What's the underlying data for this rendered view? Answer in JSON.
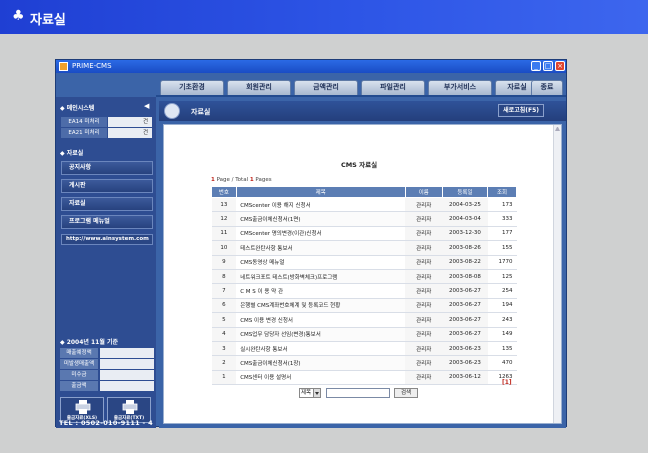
{
  "page": {
    "title": "자료실"
  },
  "window": {
    "title": "PRIME-CMS"
  },
  "menu": {
    "tabs": [
      {
        "label": "기초환경"
      },
      {
        "label": "회원관리"
      },
      {
        "label": "금액관리"
      },
      {
        "label": "파일관리"
      },
      {
        "label": "부가서비스"
      },
      {
        "label": "자료실"
      },
      {
        "label": "종료"
      }
    ]
  },
  "sidebar": {
    "main_system": "메인시스템",
    "counts": [
      {
        "label": "EA14 미처리",
        "value": "건"
      },
      {
        "label": "EA21 미처리",
        "value": "건"
      }
    ],
    "archive_head": "자료실",
    "nav": [
      {
        "label": "공지사항"
      },
      {
        "label": "게시판"
      },
      {
        "label": "자료실"
      },
      {
        "label": "프로그램 메뉴얼"
      }
    ],
    "url": "http://www.ainsystem.com",
    "stats_head": "2004년 11월 기준",
    "stats": [
      {
        "label": "매출예정액"
      },
      {
        "label": "미발생매출액"
      },
      {
        "label": "미수금"
      },
      {
        "label": "출금액"
      }
    ],
    "printers": [
      {
        "label": "출금자료(XLS)"
      },
      {
        "label": "출금자료(TXT)"
      }
    ],
    "phone": "TEL : 0502-010-9111 - 4"
  },
  "content": {
    "title": "자료실",
    "refresh_label": "새로고침(F5)",
    "board_title": "CMS 자료실",
    "page_current": "1",
    "page_total": "1",
    "page_text_a": " Page / Total ",
    "page_text_b": " Pages",
    "columns": {
      "no": "번호",
      "subject": "제목",
      "name": "이름",
      "date": "등록일",
      "views": "조회"
    },
    "rows": [
      {
        "no": "13",
        "subject": "CMScenter 이용 해지 신청서",
        "name": "관리자",
        "date": "2004-03-25",
        "views": "173"
      },
      {
        "no": "12",
        "subject": "CMS출금이체신청서(1면)",
        "name": "관리자",
        "date": "2004-03-04",
        "views": "333"
      },
      {
        "no": "11",
        "subject": "CMScenter 명의변경(이관)신청서",
        "name": "관리자",
        "date": "2003-12-30",
        "views": "177"
      },
      {
        "no": "10",
        "subject": "테스트완탄사항 통보서",
        "name": "관리자",
        "date": "2003-08-26",
        "views": "155"
      },
      {
        "no": "9",
        "subject": "CMS동영상 메뉴얼",
        "name": "관리자",
        "date": "2003-08-22",
        "views": "1770"
      },
      {
        "no": "8",
        "subject": "네트워크포트 테스트(방화벽체크)프로그램",
        "name": "관리자",
        "date": "2003-08-08",
        "views": "125"
      },
      {
        "no": "7",
        "subject": "C M S 이 용 약 관",
        "name": "관리자",
        "date": "2003-06-27",
        "views": "254"
      },
      {
        "no": "6",
        "subject": "은행별 CMS계좌번호체계 및 등록코드 현황",
        "name": "관리자",
        "date": "2003-06-27",
        "views": "194"
      },
      {
        "no": "5",
        "subject": "CMS 이용 변경 신청서",
        "name": "관리자",
        "date": "2003-06-27",
        "views": "243"
      },
      {
        "no": "4",
        "subject": "CMS업무 담당자 선임(변경)통보서",
        "name": "관리자",
        "date": "2003-06-27",
        "views": "149"
      },
      {
        "no": "3",
        "subject": "실시완탄사항 통보서",
        "name": "관리자",
        "date": "2003-06-23",
        "views": "135"
      },
      {
        "no": "2",
        "subject": "CMS출금이체신청서(1장)",
        "name": "관리자",
        "date": "2003-06-23",
        "views": "470"
      },
      {
        "no": "1",
        "subject": "CMS센터 이용 설명서",
        "name": "관리자",
        "date": "2003-06-12",
        "views": "1263"
      }
    ],
    "page_link": "[1]",
    "search": {
      "field": "제목",
      "button": "검색"
    }
  }
}
